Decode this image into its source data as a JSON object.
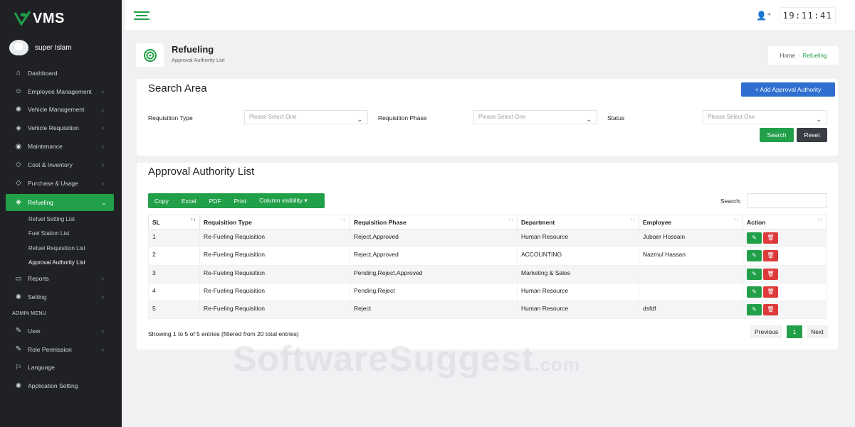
{
  "app": {
    "logo_text": "VMS",
    "user_name": "super Islam"
  },
  "colors": {
    "sidebar_bg": "#1f2124",
    "accent": "#22a049",
    "primary_blue": "#2f6fcf",
    "danger": "#dd3b3b"
  },
  "sidebar": {
    "items": [
      {
        "label": "Dashboard",
        "icon": "home-icon",
        "chevron": ""
      },
      {
        "label": "Employee Management",
        "icon": "users-icon",
        "chevron": "‹"
      },
      {
        "label": "Vehicle Management",
        "icon": "gear-icon",
        "chevron": "‹"
      },
      {
        "label": "Vehicle Requisition",
        "icon": "tag-icon",
        "chevron": "‹"
      },
      {
        "label": "Maintenance",
        "icon": "compass-icon",
        "chevron": "‹"
      },
      {
        "label": "Cost & Inventory",
        "icon": "tag-icon",
        "chevron": "‹"
      },
      {
        "label": "Purchase & Usage",
        "icon": "tag-icon",
        "chevron": "‹"
      },
      {
        "label": "Refueling",
        "icon": "fuel-icon",
        "chevron": "⌄"
      }
    ],
    "sub_items": [
      {
        "label": "Refuel Setting List"
      },
      {
        "label": "Fuel Station List"
      },
      {
        "label": "Refuel Requisition List"
      },
      {
        "label": "Approval Authority List"
      }
    ],
    "bottom_items": [
      {
        "label": "Reports",
        "icon": "folder-icon",
        "chevron": "‹"
      },
      {
        "label": "Setting",
        "icon": "gear-icon",
        "chevron": "‹"
      }
    ],
    "admin_heading": "ADMIN MENU",
    "admin_items": [
      {
        "label": "User",
        "icon": "edit-icon",
        "chevron": "‹"
      },
      {
        "label": "Role Permission",
        "icon": "edit-icon",
        "chevron": "‹"
      },
      {
        "label": "Language",
        "icon": "flag-icon",
        "chevron": ""
      },
      {
        "label": "Application Setting",
        "icon": "gear-icon",
        "chevron": ""
      }
    ]
  },
  "topbar": {
    "clock": "19:11:41"
  },
  "page": {
    "title": "Refueling",
    "subtitle": "Approval Authority List"
  },
  "breadcrumb": {
    "home": "Home",
    "separator": "-",
    "current": "Refueling"
  },
  "search_area": {
    "title": "Search Area",
    "add_button": "+ Add Approval Authority",
    "requisition_type_label": "Requisition Type",
    "requisition_type_value": "Please Select One",
    "requisition_phase_label": "Requisition Phase",
    "requisition_phase_value": "Please Select One",
    "status_label": "Status",
    "status_value": "Please Select One",
    "search_button": "Search",
    "reset_button": "Reset"
  },
  "list": {
    "title": "Approval Authority List",
    "export_buttons": [
      "Copy",
      "Excel",
      "PDF",
      "Print",
      "Column visibility ▾"
    ],
    "search_label": "Search:",
    "columns": [
      "SL",
      "Requisition Type",
      "Requisition Phase",
      "Department",
      "Employee",
      "Action"
    ],
    "rows": [
      {
        "sl": "1",
        "type": "Re-Fueling Requisition",
        "phase": "Reject,Approved",
        "department": "Human Resource",
        "employee": "Jubaer Hossain"
      },
      {
        "sl": "2",
        "type": "Re-Fueling Requisition",
        "phase": "Reject,Approved",
        "department": "ACCOUNTING",
        "employee": "Nazmul Hassan"
      },
      {
        "sl": "3",
        "type": "Re-Fueling Requisition",
        "phase": "Pending,Reject,Approved",
        "department": "Marketing & Sales",
        "employee": ""
      },
      {
        "sl": "4",
        "type": "Re-Fueling Requisition",
        "phase": "Pending,Reject",
        "department": "Human Resource",
        "employee": ""
      },
      {
        "sl": "5",
        "type": "Re-Fueling Requisition",
        "phase": "Reject",
        "department": "Human Resource",
        "employee": "dsfdf"
      }
    ],
    "info": "Showing 1 to 5 of 5 entries (filtered from 20 total entries)",
    "pagination": {
      "previous": "Previous",
      "page": "1",
      "next": "Next"
    }
  },
  "watermark": {
    "main": "SoftwareSuggest",
    "suffix": ".com"
  }
}
